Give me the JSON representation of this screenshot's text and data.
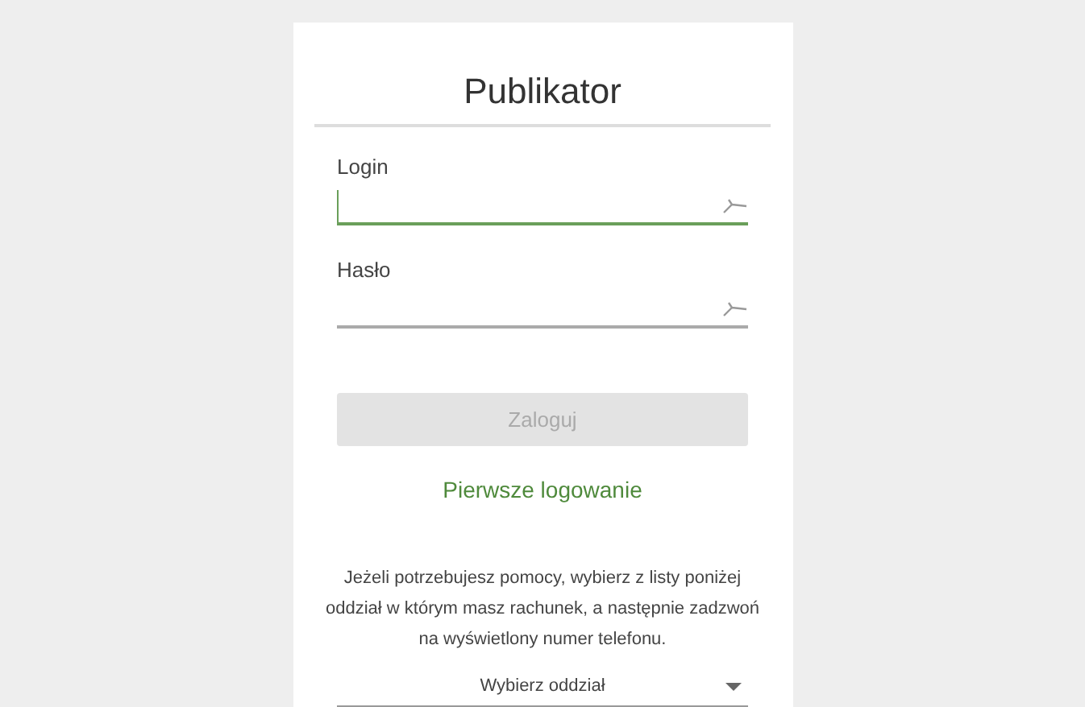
{
  "title": "Publikator",
  "fields": [
    {
      "label": "Login",
      "focused": true
    },
    {
      "label": "Hasło",
      "focused": false
    }
  ],
  "login_button": {
    "label": "Zaloguj",
    "disabled": true
  },
  "first_login_link": "Pierwsze logowanie",
  "help_text": "Jeżeli potrzebujesz pomocy, wybierz z listy poniżej oddział w którym masz rachunek, a następnie zadzwoń na wyświetlony numer telefonu.",
  "branch_select": {
    "placeholder": "Wybierz oddział"
  }
}
